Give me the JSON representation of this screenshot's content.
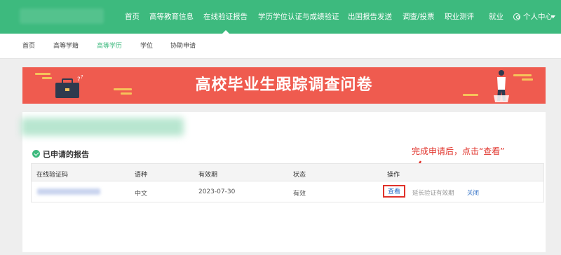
{
  "topnav": {
    "items": [
      "首页",
      "高等教育信息",
      "在线验证报告",
      "学历学位认证与成绩验证",
      "出国报告发送",
      "调查/投票",
      "职业测评",
      "就业"
    ],
    "user_center": "个人中心",
    "active_index": 2
  },
  "subnav": {
    "items": [
      "首页",
      "高等学籍",
      "高等学历",
      "学位",
      "协助申请"
    ],
    "active_index": 2
  },
  "banner": {
    "title": "高校毕业生跟踪调查问卷"
  },
  "section": {
    "title": "已申请的报告"
  },
  "annotation": "完成申请后，点击“查看”",
  "table": {
    "headers": [
      "在线验证码",
      "语种",
      "有效期",
      "状态",
      "操作"
    ],
    "row": {
      "language": "中文",
      "validity": "2023-07-30",
      "status": "有效",
      "actions": {
        "view": "查看",
        "extend": "延长验证有效期",
        "close": "关闭"
      }
    }
  },
  "colors": {
    "primary_green": "#3dba7e",
    "banner_red": "#ef5b4f",
    "annotation_red": "#e0322a",
    "link_blue": "#3b77c8"
  }
}
